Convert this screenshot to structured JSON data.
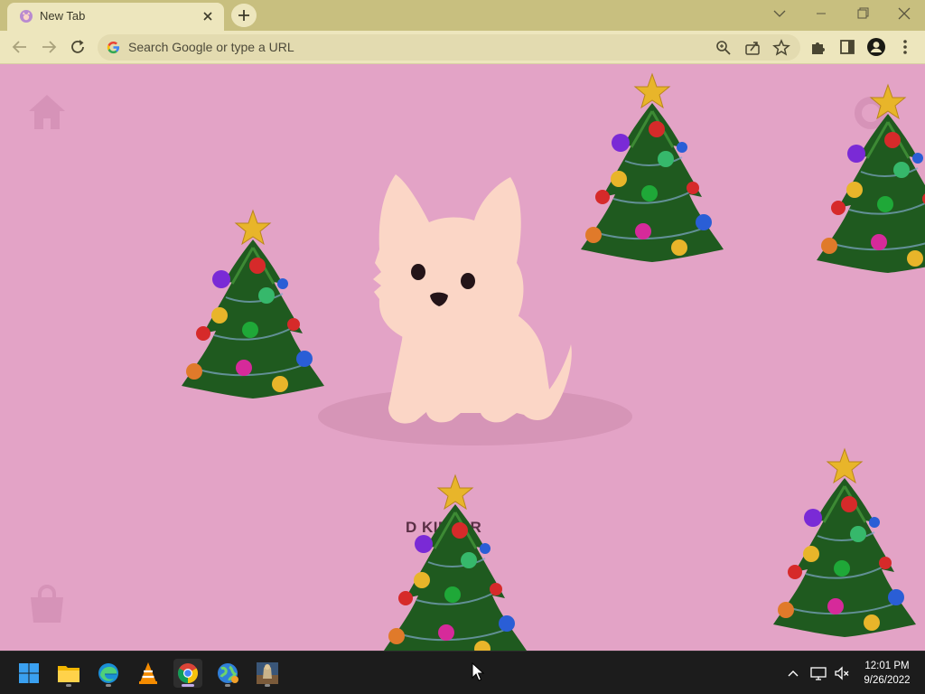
{
  "browser": {
    "tab": {
      "title": "New Tab"
    },
    "omnibox": {
      "placeholder": "Search Google or type a URL"
    }
  },
  "page": {
    "background_color": "#e3a3c6",
    "dog_name": "D        KIPPER",
    "corner_icons": [
      "home-icon",
      "shopping-bag-icon",
      "settings-icon"
    ],
    "decorations": [
      "christmas-tree",
      "christmas-tree",
      "christmas-tree",
      "christmas-tree",
      "christmas-tree"
    ]
  },
  "taskbar": {
    "apps": [
      "windows-start-icon",
      "file-explorer-icon",
      "edge-icon",
      "vlc-icon",
      "chrome-icon",
      "globe-app-icon",
      "game-app-icon"
    ],
    "active_app": "chrome-icon",
    "clock": {
      "time": "12:01 PM",
      "date": "9/26/2022"
    }
  },
  "colors": {
    "titlebar": "#c8bf7f",
    "toolbar": "#ede6bd",
    "taskbar": "#1c1c1c",
    "dog": "#fbd6c6"
  }
}
